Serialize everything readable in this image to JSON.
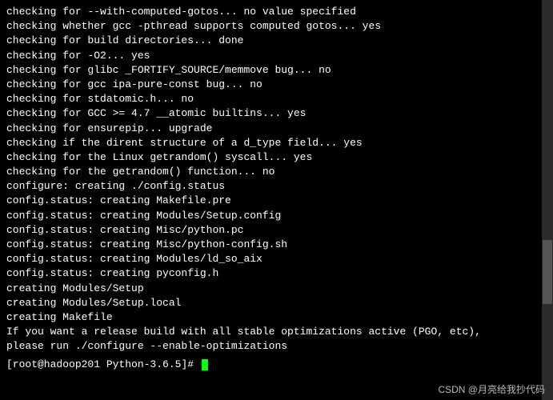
{
  "lines": [
    "checking for --with-computed-gotos... no value specified",
    "checking whether gcc -pthread supports computed gotos... yes",
    "checking for build directories... done",
    "checking for -O2... yes",
    "checking for glibc _FORTIFY_SOURCE/memmove bug... no",
    "checking for gcc ipa-pure-const bug... no",
    "checking for stdatomic.h... no",
    "checking for GCC >= 4.7 __atomic builtins... yes",
    "checking for ensurepip... upgrade",
    "checking if the dirent structure of a d_type field... yes",
    "checking for the Linux getrandom() syscall... yes",
    "checking for the getrandom() function... no",
    "configure: creating ./config.status",
    "config.status: creating Makefile.pre",
    "config.status: creating Modules/Setup.config",
    "config.status: creating Misc/python.pc",
    "config.status: creating Misc/python-config.sh",
    "config.status: creating Modules/ld_so_aix",
    "config.status: creating pyconfig.h",
    "creating Modules/Setup",
    "creating Modules/Setup.local",
    "creating Makefile",
    "",
    "",
    "If you want a release build with all stable optimizations active (PGO, etc),",
    "please run ./configure --enable-optimizations",
    "",
    ""
  ],
  "prompt": "[root@hadoop201 Python-3.6.5]# ",
  "watermark": "CSDN @月亮给我抄代码"
}
